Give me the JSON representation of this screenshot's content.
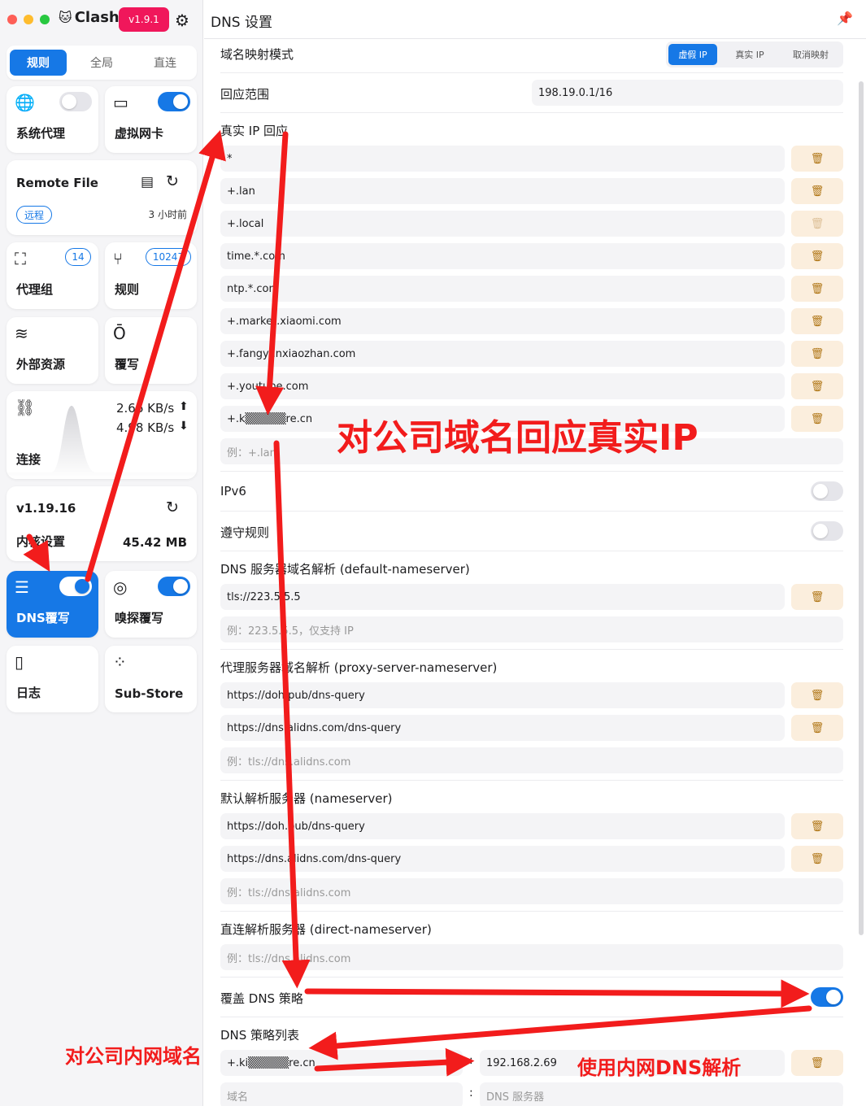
{
  "app": {
    "name": "Clash",
    "version": "v1.9.1"
  },
  "sidebar": {
    "mode_tabs": [
      "规则",
      "全局",
      "直连"
    ],
    "cards": {
      "system_proxy": "系统代理",
      "tun": "虚拟网卡",
      "remote_file": {
        "title": "Remote File",
        "tag": "远程",
        "updated": "3 小时前"
      },
      "proxy_groups": {
        "label": "代理组",
        "count": "14"
      },
      "rules": {
        "label": "规则",
        "count": "10247"
      },
      "external": "外部资源",
      "override": "覆写",
      "connections": {
        "label": "连接",
        "up": "2.66 KB/s",
        "down": "4.98 KB/s"
      },
      "core": {
        "version": "v1.19.16",
        "label": "内核设置",
        "memory": "45.42 MB"
      },
      "dns": "DNS覆写",
      "sniff": "嗅探覆写",
      "logs": "日志",
      "substore": "Sub-Store"
    }
  },
  "main": {
    "title": "DNS 设置",
    "enhanced_mode": {
      "label": "域名映射模式",
      "options": [
        "虚假 IP",
        "真实 IP",
        "取消映射"
      ]
    },
    "fake_ip_range": {
      "label": "回应范围",
      "value": "198.19.0.1/16"
    },
    "fake_ip_filter": {
      "label": "真实 IP 回应",
      "items": [
        "*",
        "+.lan",
        "+.local",
        "time.*.com",
        "ntp.*.com",
        "+.market.xiaomi.com",
        "+.fangyanxiaozhan.com",
        "+.youtube.com",
        "+.k▒▒▒▒▒re.cn"
      ],
      "placeholder": "例：+.lan"
    },
    "ipv6": {
      "label": "IPv6"
    },
    "respect_rules": {
      "label": "遵守规则"
    },
    "default_nameserver": {
      "label": "DNS 服务器域名解析 (default-nameserver)",
      "items": [
        "tls://223.5.5.5"
      ],
      "placeholder": "例：223.5.5.5，仅支持 IP"
    },
    "proxy_server_nameserver": {
      "label": "代理服务器域名解析 (proxy-server-nameserver)",
      "items": [
        "https://doh.pub/dns-query",
        "https://dns.alidns.com/dns-query"
      ],
      "placeholder": "例：tls://dns.alidns.com"
    },
    "nameserver": {
      "label": "默认解析服务器 (nameserver)",
      "items": [
        "https://doh.pub/dns-query",
        "https://dns.alidns.com/dns-query"
      ],
      "placeholder": "例：tls://dns.alidns.com"
    },
    "direct_nameserver": {
      "label": "直连解析服务器 (direct-nameserver)",
      "placeholder": "例：tls://dns.alidns.com"
    },
    "override_policy": {
      "label": "覆盖 DNS 策略"
    },
    "policy_list": {
      "label": "DNS 策略列表",
      "domain": "+.ki▒▒▒▒▒re.cn",
      "server": "192.168.2.69",
      "separator": ":",
      "domain_placeholder": "域名",
      "server_placeholder": "DNS 服务器"
    }
  },
  "annotations": {
    "real_ip": "对公司域名回应真实IP",
    "intranet_domain": "对公司内网域名",
    "intranet_dns": "使用内网DNS解析"
  },
  "colors": {
    "accent": "#1678e6",
    "annotation": "#f21c1c",
    "version_badge": "#f0175b",
    "delete_bg": "#fbeedd"
  }
}
